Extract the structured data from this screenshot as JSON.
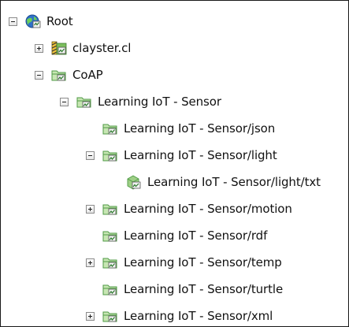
{
  "tree": {
    "nodes": [
      {
        "label": "Root",
        "toggle": "minus",
        "icon": "globe-icon",
        "depth": 0
      },
      {
        "label": "clayster.cl",
        "toggle": "plus",
        "icon": "server-striped-icon",
        "depth": 1
      },
      {
        "label": "CoAP",
        "toggle": "minus",
        "icon": "coap-folder-icon",
        "depth": 1
      },
      {
        "label": "Learning IoT - Sensor",
        "toggle": "minus",
        "icon": "sensor-folder-icon",
        "depth": 2
      },
      {
        "label": "Learning IoT - Sensor/json",
        "toggle": "none",
        "icon": "sensor-folder-icon",
        "depth": 3
      },
      {
        "label": "Learning IoT - Sensor/light",
        "toggle": "minus",
        "icon": "sensor-folder-icon",
        "depth": 3
      },
      {
        "label": "Learning IoT - Sensor/light/txt",
        "toggle": "none",
        "icon": "cube-doc-icon",
        "depth": 4
      },
      {
        "label": "Learning IoT - Sensor/motion",
        "toggle": "plus",
        "icon": "sensor-folder-icon",
        "depth": 3
      },
      {
        "label": "Learning IoT - Sensor/rdf",
        "toggle": "none",
        "icon": "sensor-folder-icon",
        "depth": 3
      },
      {
        "label": "Learning IoT - Sensor/temp",
        "toggle": "plus",
        "icon": "sensor-folder-icon",
        "depth": 3
      },
      {
        "label": "Learning IoT - Sensor/turtle",
        "toggle": "none",
        "icon": "sensor-folder-icon",
        "depth": 3
      },
      {
        "label": "Learning IoT - Sensor/xml",
        "toggle": "plus",
        "icon": "sensor-folder-icon",
        "depth": 3
      }
    ]
  },
  "colors": {
    "folder_green": "#4f9a45",
    "folder_light": "#c7e6b3",
    "globe_blue": "#2f6fc9",
    "text": "#111111"
  }
}
